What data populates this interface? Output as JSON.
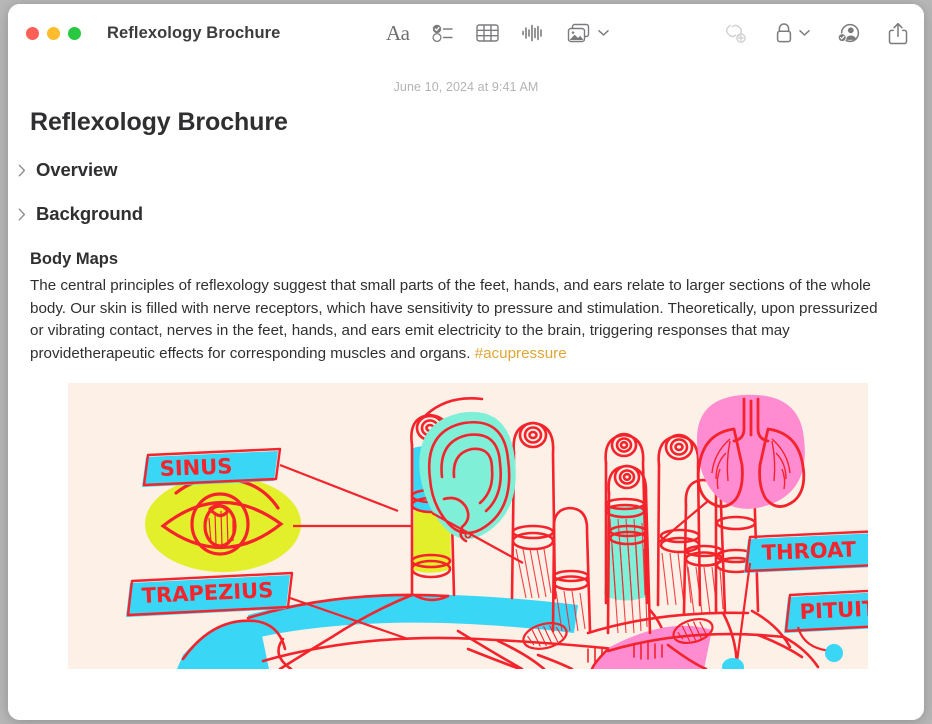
{
  "window": {
    "title": "Reflexology Brochure",
    "traffic_lights": [
      {
        "name": "close",
        "color": "#ff5f57"
      },
      {
        "name": "minimize",
        "color": "#febc2e"
      },
      {
        "name": "zoom",
        "color": "#28c840"
      }
    ]
  },
  "toolbar": {
    "center_items": [
      {
        "name": "format",
        "icon": "Aa",
        "label": "Aa"
      },
      {
        "name": "checklist",
        "icon": "checklist-icon"
      },
      {
        "name": "table",
        "icon": "table-icon"
      },
      {
        "name": "audio",
        "icon": "waveform-icon"
      },
      {
        "name": "media",
        "icon": "photos-icon",
        "has_chevron": true
      }
    ],
    "right_items": [
      {
        "name": "link",
        "icon": "link-add-icon",
        "disabled": true
      },
      {
        "name": "lock",
        "icon": "lock-icon",
        "has_chevron": true
      },
      {
        "name": "collaborate",
        "icon": "person-check-icon"
      },
      {
        "name": "share",
        "icon": "share-icon"
      }
    ]
  },
  "note": {
    "date": "June 10, 2024 at 9:41 AM",
    "title": "Reflexology Brochure",
    "sections": [
      {
        "label": "Overview",
        "collapsed": true
      },
      {
        "label": "Background",
        "collapsed": true
      }
    ],
    "body": {
      "heading": "Body Maps",
      "paragraph": "The central principles of reflexology suggest that small parts of the feet, hands, and ears relate to larger sections of the whole body. Our skin is filled with nerve receptors, which have sensitivity to pressure and stimulation. Theoretically, upon pressurized or vibrating contact, nerves in the feet, hands, and ears emit electricity to the brain, triggering responses that may providetherapeutic effects for corresponding muscles and organs. ",
      "hashtag": "#acupressure"
    },
    "illustration": {
      "alt": "Hand reflexology body map diagram",
      "background_color": "#fdf0e6",
      "ink_color": "#f5232b",
      "labels": [
        {
          "text": "SINUS",
          "color": "#3ad6f5"
        },
        {
          "text": "TRAPEZIUS",
          "color": "#3ad6f5"
        },
        {
          "text": "THROAT",
          "color": "#3ad6f5"
        },
        {
          "text": "PITUITARY",
          "color": "#3ad6f5"
        }
      ],
      "organs": [
        {
          "name": "eye",
          "blob_color": "#e4ef2c"
        },
        {
          "name": "ear",
          "blob_color": "#7fefd8"
        },
        {
          "name": "lungs",
          "blob_color": "#ff8cd0"
        }
      ]
    }
  }
}
